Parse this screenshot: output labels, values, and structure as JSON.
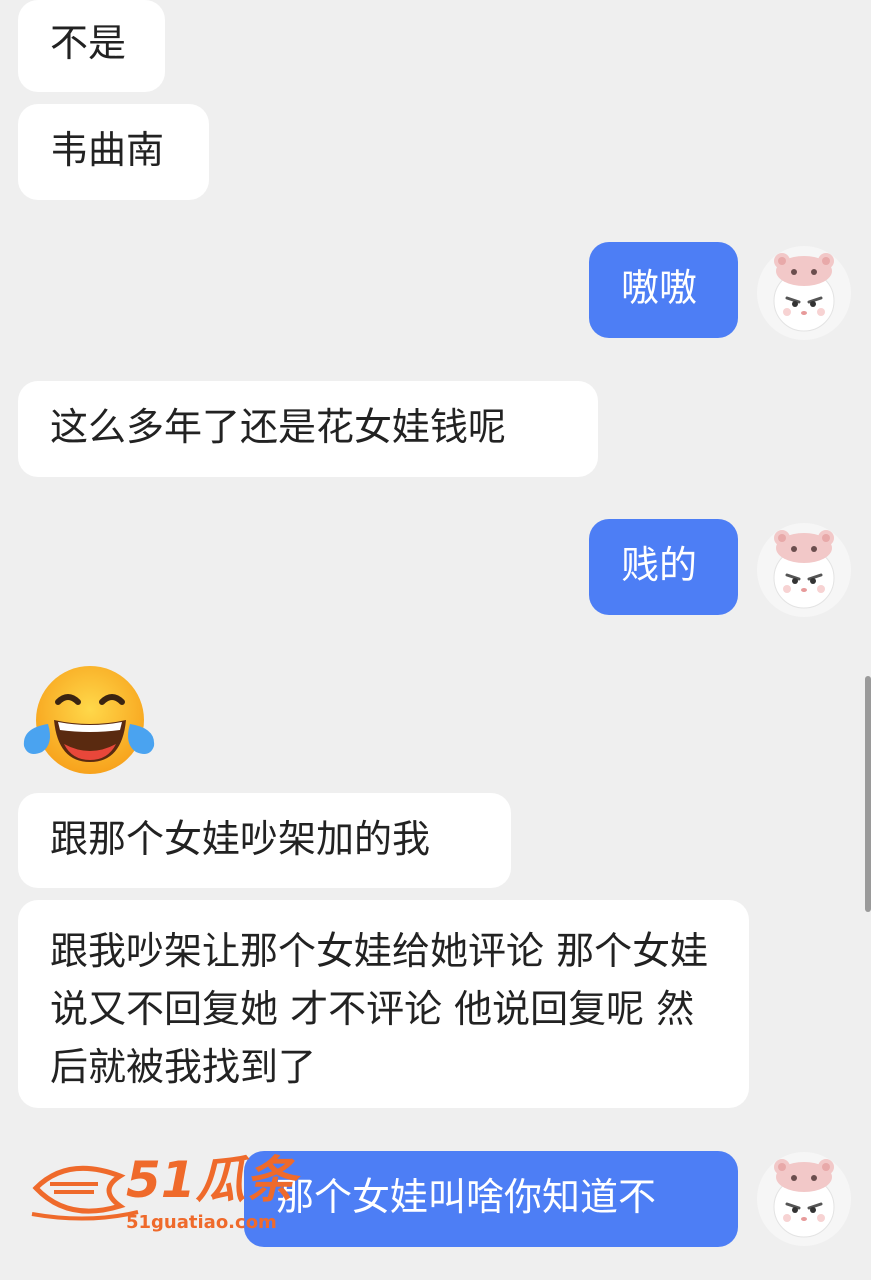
{
  "messages": [
    {
      "side": "in",
      "text": "不是"
    },
    {
      "side": "in",
      "text": "韦曲南"
    },
    {
      "side": "out",
      "text": "嗷嗷"
    },
    {
      "side": "in",
      "text": "这么多年了还是花女娃钱呢"
    },
    {
      "side": "out",
      "text": "贱的"
    },
    {
      "side": "in",
      "type": "emoji",
      "emoji": "laughing-crying-emoji"
    },
    {
      "side": "in",
      "text": "跟那个女娃吵架加的我"
    },
    {
      "side": "in",
      "text": "跟我吵架让那个女娃给她评论 那个女娃说又不回复她 才不评论 他说回复呢 然后就被我找到了"
    },
    {
      "side": "out",
      "text": "那个女娃叫啥你知道不"
    }
  ],
  "watermark": {
    "brand": "51瓜条",
    "url": "51guatiao.com"
  },
  "colors": {
    "background": "#efefef",
    "incoming_bubble": "#ffffff",
    "outgoing_bubble": "#4d7ef5",
    "watermark": "#ef6a2b"
  }
}
